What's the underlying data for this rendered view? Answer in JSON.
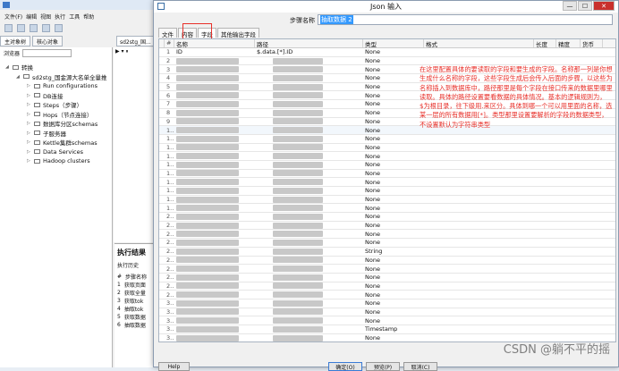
{
  "app": {
    "menu": [
      "文件(F)",
      "编辑",
      "视图",
      "执行",
      "工具",
      "帮助"
    ],
    "tabs": [
      "主对象树",
      "核心对象"
    ],
    "explorer_label": "浏览器",
    "tree": [
      {
        "label": "转换",
        "level": 0,
        "open": true
      },
      {
        "label": "sd2stg_国金源大名单全量推",
        "level": 1,
        "open": true
      },
      {
        "label": "Run configurations",
        "level": 2
      },
      {
        "label": "DB连接",
        "level": 2
      },
      {
        "label": "Steps（步骤）",
        "level": 2
      },
      {
        "label": "Hops（节点连接）",
        "level": 2
      },
      {
        "label": "数据库分区schemas",
        "level": 2
      },
      {
        "label": "子服务器",
        "level": 2
      },
      {
        "label": "Kettle集群schemas",
        "level": 2
      },
      {
        "label": "Data Services",
        "level": 2
      },
      {
        "label": "Hadoop clusters",
        "level": 2
      }
    ],
    "canvas_tab": "sd2stg_国...",
    "exec": {
      "title": "执行结果",
      "history": "执行历史",
      "column_label": "步骤名称",
      "rows": [
        {
          "n": "1",
          "name": "获取页面"
        },
        {
          "n": "2",
          "name": "获取全量"
        },
        {
          "n": "3",
          "name": "获取tok"
        },
        {
          "n": "4",
          "name": "抽取tok"
        },
        {
          "n": "5",
          "name": "获取数据"
        },
        {
          "n": "6",
          "name": "抽取数据"
        }
      ]
    }
  },
  "dialog": {
    "title": "Json 输入",
    "close_label": "✕",
    "min_label": "—",
    "max_label": "☐",
    "step_name_label": "步骤名称",
    "step_name_value": "抽取数据 2",
    "tabs": [
      "文件",
      "内容",
      "字段",
      "其他输出字段"
    ],
    "columns": [
      "#",
      "名称",
      "路径",
      "类型",
      "格式",
      "长度",
      "精度",
      "货币"
    ],
    "rows": [
      {
        "n": "1",
        "name": "ID",
        "path": "$.data.[*].ID",
        "type": "None"
      },
      {
        "n": "2",
        "name": "",
        "path": "",
        "type": "None"
      },
      {
        "n": "3",
        "name": "",
        "path": "",
        "type": "None"
      },
      {
        "n": "4",
        "name": "",
        "path": "",
        "type": "None"
      },
      {
        "n": "5",
        "name": "",
        "path": "",
        "type": "None"
      },
      {
        "n": "6",
        "name": "",
        "path": "",
        "type": "None"
      },
      {
        "n": "7",
        "name": "",
        "path": "",
        "type": "None"
      },
      {
        "n": "8",
        "name": "",
        "path": "",
        "type": "None"
      },
      {
        "n": "9",
        "name": "",
        "path": "",
        "type": "None"
      },
      {
        "n": "1...",
        "name": "",
        "path": "",
        "type": "None"
      },
      {
        "n": "1...",
        "name": "",
        "path": "",
        "type": "None"
      },
      {
        "n": "1...",
        "name": "",
        "path": "",
        "type": "None"
      },
      {
        "n": "1...",
        "name": "",
        "path": "",
        "type": "None"
      },
      {
        "n": "1...",
        "name": "",
        "path": "",
        "type": "None"
      },
      {
        "n": "1...",
        "name": "",
        "path": "",
        "type": "None"
      },
      {
        "n": "1...",
        "name": "",
        "path": "",
        "type": "None"
      },
      {
        "n": "1...",
        "name": "",
        "path": "",
        "type": "None"
      },
      {
        "n": "1...",
        "name": "",
        "path": "",
        "type": "None"
      },
      {
        "n": "1...",
        "name": "",
        "path": "",
        "type": "None"
      },
      {
        "n": "2...",
        "name": "",
        "path": "",
        "type": "None"
      },
      {
        "n": "2...",
        "name": "",
        "path": "",
        "type": "None"
      },
      {
        "n": "2...",
        "name": "",
        "path": "",
        "type": "None"
      },
      {
        "n": "2...",
        "name": "",
        "path": "",
        "type": "None"
      },
      {
        "n": "2...",
        "name": "",
        "path": "",
        "type": "String"
      },
      {
        "n": "2...",
        "name": "",
        "path": "",
        "type": "None"
      },
      {
        "n": "2...",
        "name": "",
        "path": "",
        "type": "None"
      },
      {
        "n": "2...",
        "name": "",
        "path": "",
        "type": "None"
      },
      {
        "n": "2...",
        "name": "",
        "path": "",
        "type": "None"
      },
      {
        "n": "2...",
        "name": "",
        "path": "",
        "type": "None"
      },
      {
        "n": "3...",
        "name": "",
        "path": "",
        "type": "None"
      },
      {
        "n": "3...",
        "name": "",
        "path": "",
        "type": "None"
      },
      {
        "n": "3...",
        "name": "",
        "path": "",
        "type": "None"
      },
      {
        "n": "3...",
        "name": "",
        "path": "",
        "type": "Timestamp"
      },
      {
        "n": "3...",
        "name": "",
        "path": "",
        "type": "None"
      }
    ],
    "annotation": "在这里配置具体的要读取的字段和要生成的字段。名称那一列是你想生成什么名称的字段，这些字段生成后会传入后面的步骤，以这些为名称插入到数据库中，路径那里是每个字段在接口传来的数据里哪里读取。具体的路径设置要看数据的具体情况。基本的逻辑规则为，$为根目录，往下级用.来区分。具体到哪一个可以用里面的名称，选某一层的所有数据用[*]。类型那里设置要解析的字段的数据类型，不设置默认为字符串类型",
    "buttons": {
      "help": "Help",
      "ok": "确定(O)",
      "preview": "预览(P)",
      "cancel": "取消(C)"
    }
  },
  "watermark": "CSDN @躺不平的摇"
}
